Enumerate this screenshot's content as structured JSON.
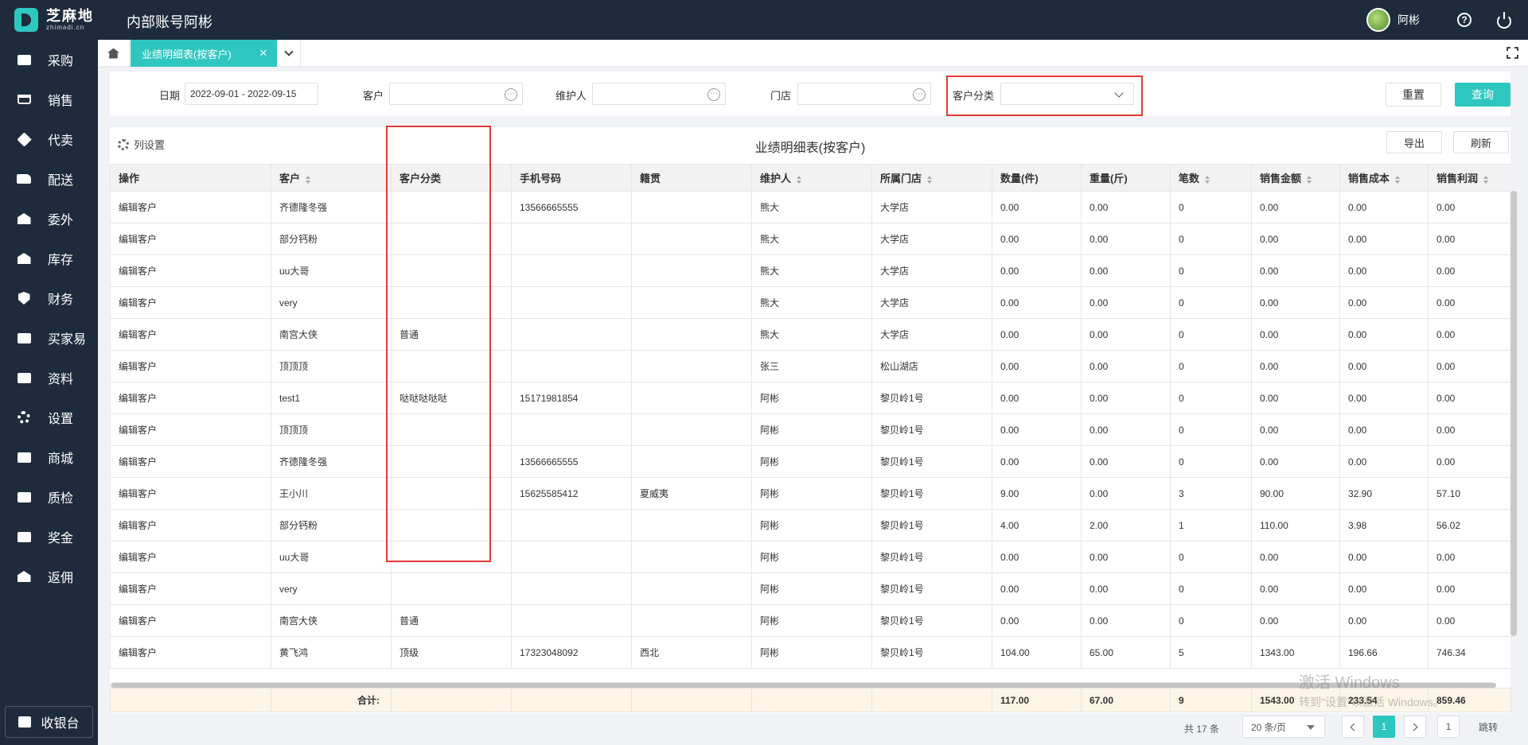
{
  "app": {
    "logo_cn": "芝麻地",
    "logo_en": "zhimadi.cn",
    "title": "内部账号阿彬",
    "user_name": "阿彬",
    "help_glyph": "?"
  },
  "sidebar": {
    "items": [
      {
        "label": "采购",
        "icon": "basket-icon"
      },
      {
        "label": "销售",
        "icon": "cart-icon"
      },
      {
        "label": "代卖",
        "icon": "tag-icon"
      },
      {
        "label": "配送",
        "icon": "truck-icon"
      },
      {
        "label": "委外",
        "icon": "warehouse-icon"
      },
      {
        "label": "库存",
        "icon": "bank-icon"
      },
      {
        "label": "财务",
        "icon": "finance-icon"
      },
      {
        "label": "买家易",
        "icon": "box-icon"
      },
      {
        "label": "资料",
        "icon": "printer-icon"
      },
      {
        "label": "设置",
        "icon": "gear-icon"
      },
      {
        "label": "商城",
        "icon": "box-icon"
      },
      {
        "label": "质检",
        "icon": "basket-icon"
      },
      {
        "label": "奖金",
        "icon": "box-icon"
      },
      {
        "label": "返佣",
        "icon": "warehouse-icon"
      }
    ],
    "cashier_label": "收银台"
  },
  "tabs": {
    "active_label": "业绩明细表(按客户)",
    "close_glyph": "×"
  },
  "filter": {
    "date_label": "日期",
    "date_value": "2022-09-01 - 2022-09-15",
    "customer_label": "客户",
    "customer_value": "",
    "maintainer_label": "维护人",
    "maintainer_value": "",
    "store_label": "门店",
    "store_value": "",
    "category_label": "客户分类",
    "category_value": "",
    "reset_label": "重置",
    "query_label": "查询",
    "dots_glyph": "···"
  },
  "report": {
    "column_settings_label": "列设置",
    "title": "业绩明细表(按客户)",
    "export_label": "导出",
    "refresh_label": "刷新"
  },
  "table": {
    "headers": [
      "操作",
      "客户",
      "客户分类",
      "手机号码",
      "籍贯",
      "维护人",
      "所属门店",
      "数量(件)",
      "重量(斤)",
      "笔数",
      "销售金额",
      "销售成本",
      "销售利润"
    ],
    "sortable": [
      false,
      true,
      false,
      false,
      false,
      true,
      true,
      false,
      false,
      true,
      true,
      true,
      true
    ],
    "rows": [
      [
        "编辑客户",
        "齐德隆冬强",
        "",
        "13566665555",
        "",
        "熊大",
        "大学店",
        "0.00",
        "0.00",
        "0",
        "0.00",
        "0.00",
        "0.00"
      ],
      [
        "编辑客户",
        "部分钙粉",
        "",
        "",
        "",
        "熊大",
        "大学店",
        "0.00",
        "0.00",
        "0",
        "0.00",
        "0.00",
        "0.00"
      ],
      [
        "编辑客户",
        "uu大哥",
        "",
        "",
        "",
        "熊大",
        "大学店",
        "0.00",
        "0.00",
        "0",
        "0.00",
        "0.00",
        "0.00"
      ],
      [
        "编辑客户",
        "very",
        "",
        "",
        "",
        "熊大",
        "大学店",
        "0.00",
        "0.00",
        "0",
        "0.00",
        "0.00",
        "0.00"
      ],
      [
        "编辑客户",
        "南宫大侠",
        "普通",
        "",
        "",
        "熊大",
        "大学店",
        "0.00",
        "0.00",
        "0",
        "0.00",
        "0.00",
        "0.00"
      ],
      [
        "编辑客户",
        "顶顶顶",
        "",
        "",
        "",
        "张三",
        "松山湖店",
        "0.00",
        "0.00",
        "0",
        "0.00",
        "0.00",
        "0.00"
      ],
      [
        "编辑客户",
        "test1",
        "哒哒哒哒哒",
        "15171981854",
        "",
        "阿彬",
        "黎贝岭1号",
        "0.00",
        "0.00",
        "0",
        "0.00",
        "0.00",
        "0.00"
      ],
      [
        "编辑客户",
        "顶顶顶",
        "",
        "",
        "",
        "阿彬",
        "黎贝岭1号",
        "0.00",
        "0.00",
        "0",
        "0.00",
        "0.00",
        "0.00"
      ],
      [
        "编辑客户",
        "齐德隆冬强",
        "",
        "13566665555",
        "",
        "阿彬",
        "黎贝岭1号",
        "0.00",
        "0.00",
        "0",
        "0.00",
        "0.00",
        "0.00"
      ],
      [
        "编辑客户",
        "王小川",
        "",
        "15625585412",
        "夏威夷",
        "阿彬",
        "黎贝岭1号",
        "9.00",
        "0.00",
        "3",
        "90.00",
        "32.90",
        "57.10"
      ],
      [
        "编辑客户",
        "部分钙粉",
        "",
        "",
        "",
        "阿彬",
        "黎贝岭1号",
        "4.00",
        "2.00",
        "1",
        "110.00",
        "3.98",
        "56.02"
      ],
      [
        "编辑客户",
        "uu大哥",
        "",
        "",
        "",
        "阿彬",
        "黎贝岭1号",
        "0.00",
        "0.00",
        "0",
        "0.00",
        "0.00",
        "0.00"
      ],
      [
        "编辑客户",
        "very",
        "",
        "",
        "",
        "阿彬",
        "黎贝岭1号",
        "0.00",
        "0.00",
        "0",
        "0.00",
        "0.00",
        "0.00"
      ],
      [
        "编辑客户",
        "南宫大侠",
        "普通",
        "",
        "",
        "阿彬",
        "黎贝岭1号",
        "0.00",
        "0.00",
        "0",
        "0.00",
        "0.00",
        "0.00"
      ],
      [
        "编辑客户",
        "黄飞鸿",
        "顶级",
        "17323048092",
        "西北",
        "阿彬",
        "黎贝岭1号",
        "104.00",
        "65.00",
        "5",
        "1343.00",
        "196.66",
        "746.34"
      ]
    ],
    "totals": [
      "",
      "合计:",
      "",
      "",
      "",
      "",
      "",
      "117.00",
      "67.00",
      "9",
      "1543.00",
      "233.54",
      "859.46"
    ]
  },
  "pagination": {
    "total_text": "共 17 条",
    "page_size": "20 条/页",
    "current_page": "1",
    "jump_value": "1",
    "jump_label": "跳转"
  },
  "watermark": {
    "line1": "激活 Windows",
    "line2": "转到\"设置\"以激活 Windows。"
  },
  "colors": {
    "sidebar_bg": "#1e2b3c",
    "accent": "#2ec7c0",
    "highlight_box": "#e53935",
    "totals_bg": "#fdf5e6"
  }
}
